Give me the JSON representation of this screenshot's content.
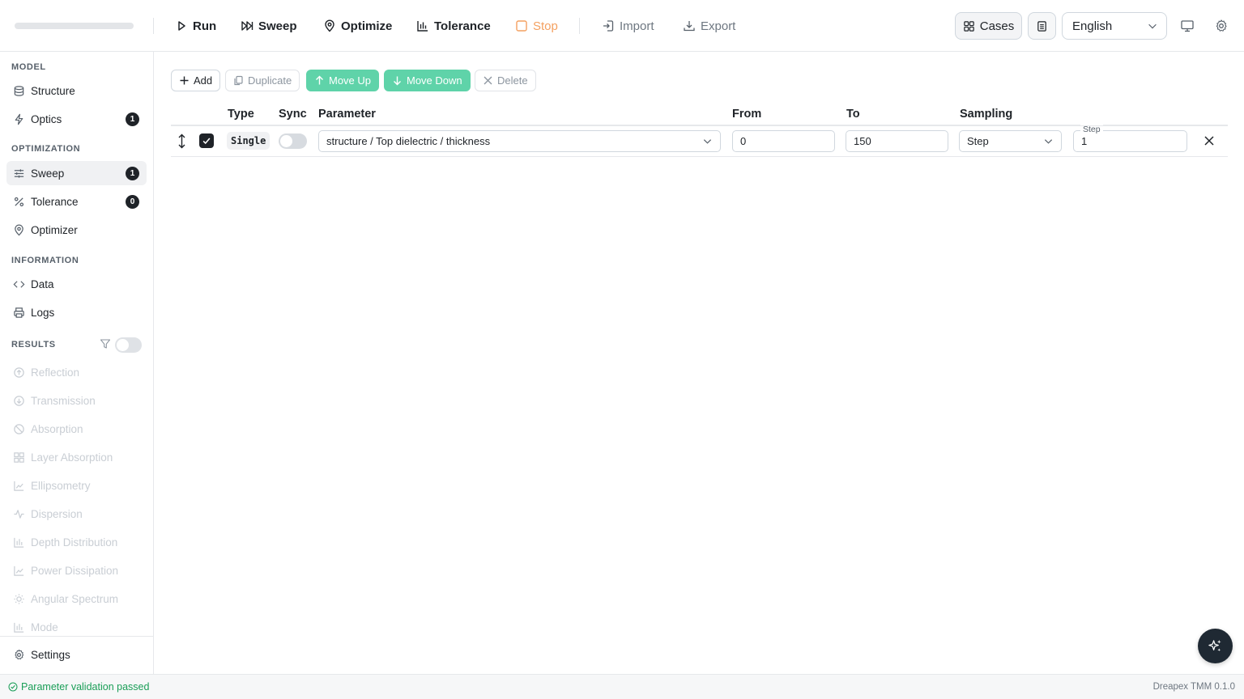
{
  "toolbar": {
    "run": "Run",
    "sweep": "Sweep",
    "optimize": "Optimize",
    "tolerance": "Tolerance",
    "stop": "Stop",
    "import": "Import",
    "export": "Export",
    "cases": "Cases",
    "language": "English"
  },
  "sidebar": {
    "model_label": "MODEL",
    "structure": "Structure",
    "optics": "Optics",
    "optics_badge": "1",
    "optimization_label": "OPTIMIZATION",
    "sweep": "Sweep",
    "sweep_badge": "1",
    "tolerance": "Tolerance",
    "tolerance_badge": "0",
    "optimizer": "Optimizer",
    "information_label": "INFORMATION",
    "data": "Data",
    "logs": "Logs",
    "results_label": "RESULTS",
    "results": [
      "Reflection",
      "Transmission",
      "Absorption",
      "Layer Absorption",
      "Ellipsometry",
      "Dispersion",
      "Depth Distribution",
      "Power Dissipation",
      "Angular Spectrum",
      "Mode"
    ],
    "settings": "Settings"
  },
  "actions": {
    "add": "Add",
    "duplicate": "Duplicate",
    "move_up": "Move Up",
    "move_down": "Move Down",
    "delete": "Delete"
  },
  "table": {
    "headers": {
      "type": "Type",
      "sync": "Sync",
      "parameter": "Parameter",
      "from": "From",
      "to": "To",
      "sampling": "Sampling"
    },
    "row": {
      "type": "Single",
      "checked": true,
      "sync": false,
      "parameter": "structure / Top dielectric / thickness",
      "from": "0",
      "to": "150",
      "sampling": "Step",
      "step_label": "Step",
      "step": "1"
    }
  },
  "status": {
    "message": "Parameter validation passed",
    "version": "Dreapex TMM 0.1.0"
  },
  "colors": {
    "accent_green": "#5fd3a9",
    "stop_orange": "#f4a060",
    "status_green": "#1a9e57",
    "dark": "#1f2328"
  }
}
